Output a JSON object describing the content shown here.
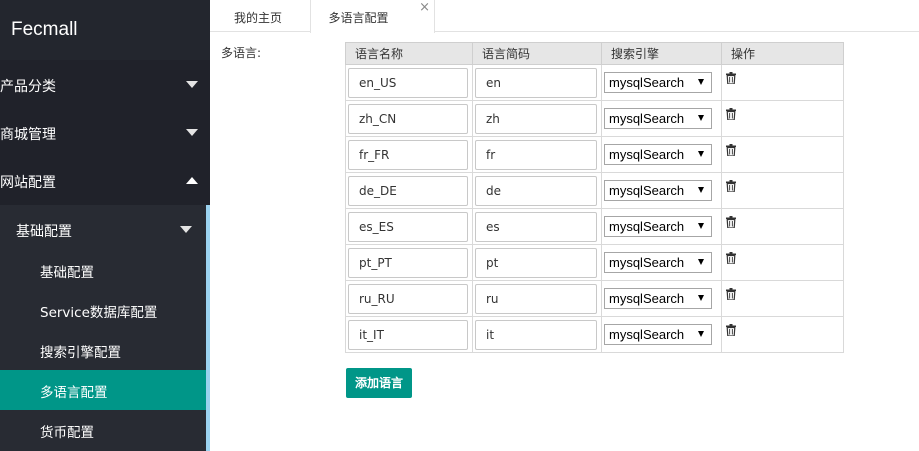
{
  "brand": "Fecmall",
  "sidebar": {
    "menus": [
      {
        "label": "产品分类",
        "expanded": false
      },
      {
        "label": "商城管理",
        "expanded": false
      },
      {
        "label": "网站配置",
        "expanded": true
      }
    ],
    "submenu": {
      "label": "基础配置",
      "items": [
        {
          "label": "基础配置"
        },
        {
          "label": "Service数据库配置"
        },
        {
          "label": "搜索引擎配置"
        },
        {
          "label": "多语言配置",
          "active": true
        },
        {
          "label": "货币配置"
        }
      ]
    }
  },
  "tabs": [
    {
      "label": "我的主页"
    },
    {
      "label": "多语言配置",
      "active": true,
      "close": "×"
    }
  ],
  "form": {
    "label": "多语言:",
    "columns": [
      "语言名称",
      "语言简码",
      "搜索引擎",
      "操作"
    ],
    "rows": [
      {
        "name": "en_US",
        "code": "en",
        "engine": "mysqlSearch"
      },
      {
        "name": "zh_CN",
        "code": "zh",
        "engine": "mysqlSearch"
      },
      {
        "name": "fr_FR",
        "code": "fr",
        "engine": "mysqlSearch"
      },
      {
        "name": "de_DE",
        "code": "de",
        "engine": "mysqlSearch"
      },
      {
        "name": "es_ES",
        "code": "es",
        "engine": "mysqlSearch"
      },
      {
        "name": "pt_PT",
        "code": "pt",
        "engine": "mysqlSearch"
      },
      {
        "name": "ru_RU",
        "code": "ru",
        "engine": "mysqlSearch"
      },
      {
        "name": "it_IT",
        "code": "it",
        "engine": "mysqlSearch"
      }
    ],
    "add_button": "添加语言",
    "delete_icon": "trash-icon"
  },
  "colors": {
    "accent": "#009688",
    "sidebar_bg": "#20222a",
    "submenu_bg": "#282b33"
  }
}
